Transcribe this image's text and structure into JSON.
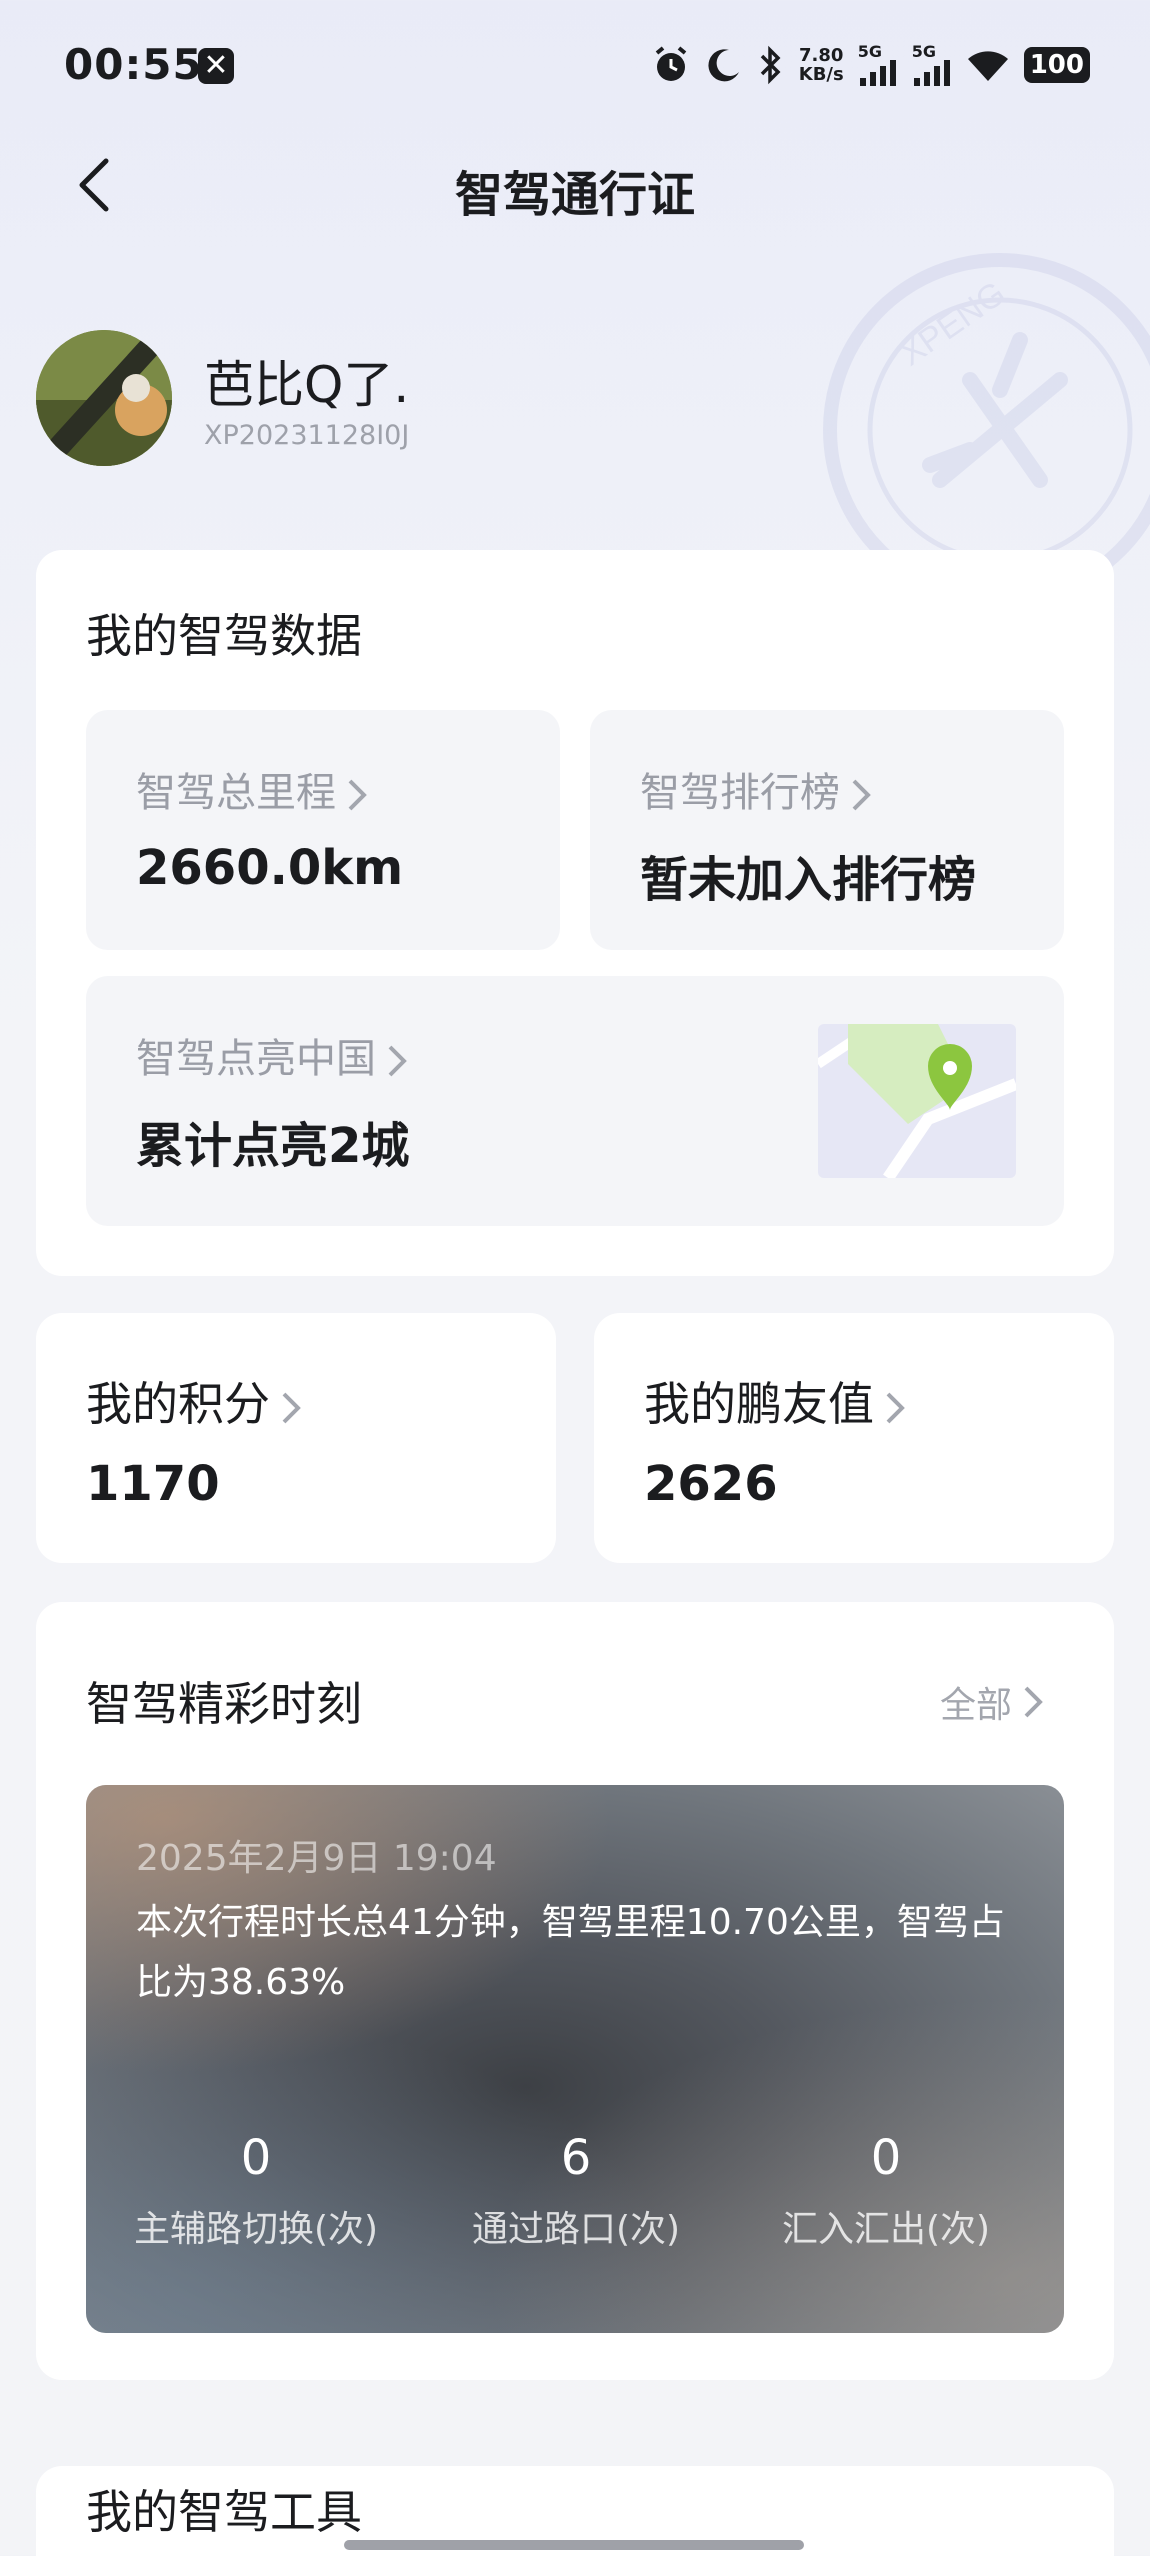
{
  "status": {
    "time": "00:55",
    "net_speed_value": "7.80",
    "net_speed_unit": "KB/s",
    "sim1": "5G",
    "sim2": "5G",
    "battery": "100"
  },
  "header": {
    "title": "智驾通行证"
  },
  "profile": {
    "name": "芭比Q了.",
    "id": "XP20231128I0J"
  },
  "data_card": {
    "title": "我的智驾数据",
    "mileage_label": "智驾总里程",
    "mileage_value": "2660.0km",
    "ranking_label": "智驾排行榜",
    "ranking_value": "暂未加入排行榜",
    "cities_label": "智驾点亮中国",
    "cities_value": "累计点亮2城"
  },
  "points": {
    "label": "我的积分",
    "value": "1170"
  },
  "friend": {
    "label": "我的鹏友值",
    "value": "2626"
  },
  "moments": {
    "title": "智驾精彩时刻",
    "all_label": "全部",
    "date": "2025年2月9日 19:04",
    "description": "本次行程时长总41分钟，智驾里程10.70公里，智驾占比为38.63%",
    "stats": [
      {
        "value": "0",
        "label": "主辅路切换(次)"
      },
      {
        "value": "6",
        "label": "通过路口(次)"
      },
      {
        "value": "0",
        "label": "汇入汇出(次)"
      }
    ]
  },
  "tools": {
    "title": "我的智驾工具"
  },
  "colors": {
    "accent_green": "#8cc63f",
    "map_bg": "#e6e7f5"
  }
}
